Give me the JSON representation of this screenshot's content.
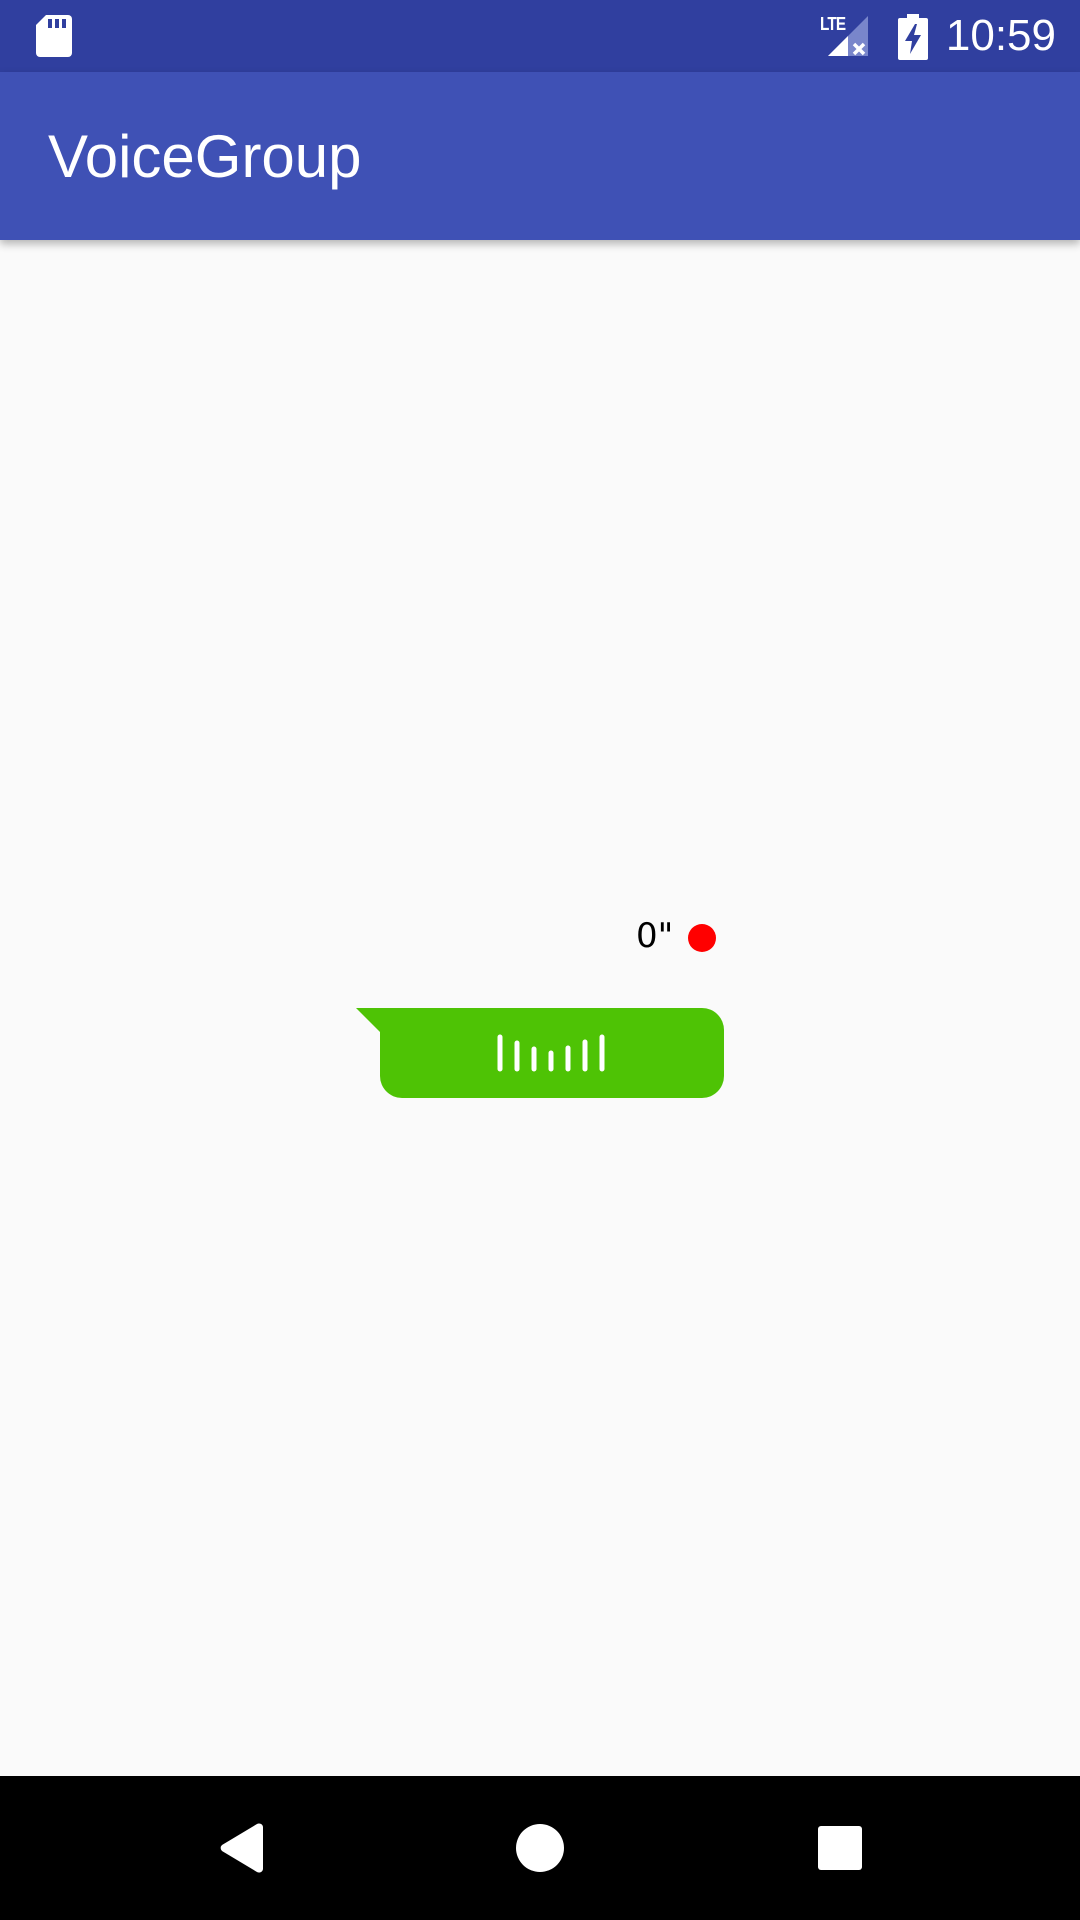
{
  "status_bar": {
    "time": "10:59",
    "network_label": "LTE",
    "icons": [
      "sd-card-icon",
      "lte-signal-no-service-icon",
      "battery-charging-icon"
    ]
  },
  "app_bar": {
    "title": "VoiceGroup"
  },
  "message": {
    "duration": "0\"",
    "unread": true,
    "bubble_color": "#4ec305",
    "unread_color": "#ff0000",
    "icon": "voice-wave-icon"
  },
  "nav_bar": {
    "buttons": [
      "back-icon",
      "home-icon",
      "recents-icon"
    ]
  },
  "colors": {
    "status_bar": "#303f9f",
    "primary": "#3f51b5",
    "background": "#fafafa"
  }
}
